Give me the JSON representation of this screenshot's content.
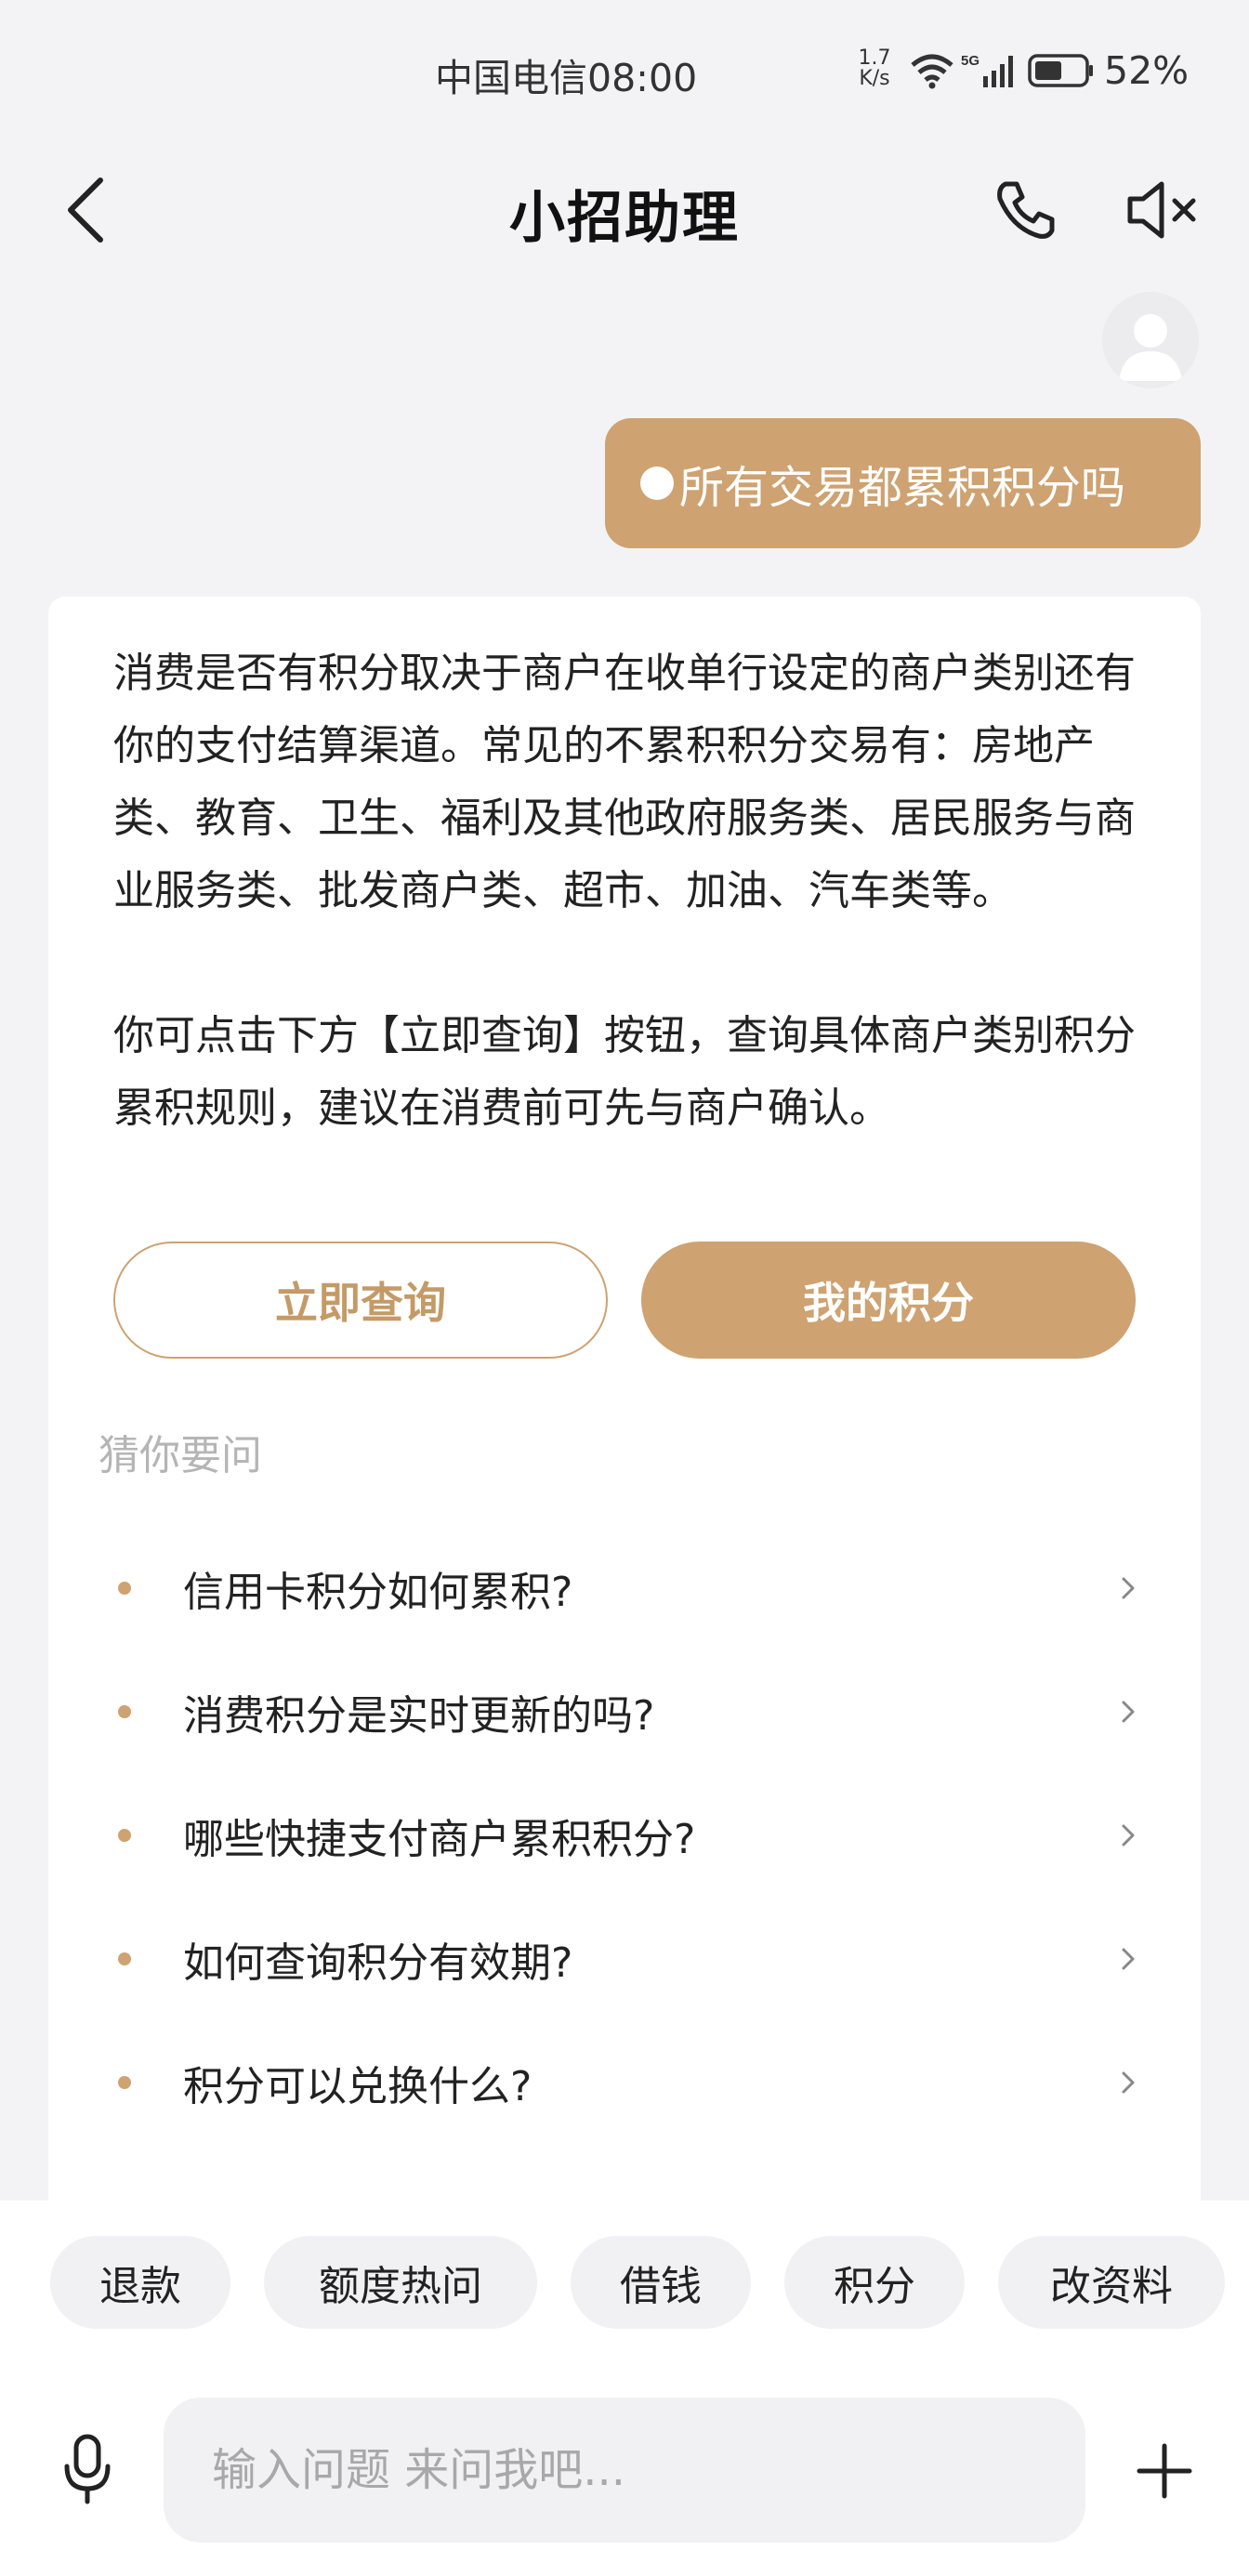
{
  "status_bar": {
    "carrier_time": "中国电信08:00",
    "net_speed_value": "1.7",
    "net_speed_unit": "K/s",
    "network_badge": "5G",
    "battery": "52%"
  },
  "header": {
    "title": "小招助理"
  },
  "user_message": {
    "text": "所有交易都累积积分吗"
  },
  "answer": {
    "paragraph1": "消费是否有积分取决于商户在收单行设定的商户类别还有你的支付结算渠道。常见的不累积积分交易有：房地产类、教育、卫生、福利及其他政府服务类、居民服务与商业服务类、批发商户类、超市、加油、汽车类等。",
    "paragraph2": "你可点击下方【立即查询】按钮，查询具体商户类别积分累积规则，建议在消费前可先与商户确认。",
    "query_button": "立即查询",
    "points_button": "我的积分"
  },
  "suggestions": {
    "title": "猜你要问",
    "items": [
      {
        "label": "信用卡积分如何累积?"
      },
      {
        "label": "消费积分是实时更新的吗?"
      },
      {
        "label": "哪些快捷支付商户累积积分?"
      },
      {
        "label": "如何查询积分有效期?"
      },
      {
        "label": "积分可以兑换什么?"
      }
    ]
  },
  "quick_chips": [
    {
      "label": "退款"
    },
    {
      "label": "额度热问"
    },
    {
      "label": "借钱"
    },
    {
      "label": "积分"
    },
    {
      "label": "改资料"
    }
  ],
  "input": {
    "placeholder": "输入问题 来问我吧..."
  },
  "colors": {
    "accent": "#cea271",
    "background": "#f3f3f5"
  }
}
